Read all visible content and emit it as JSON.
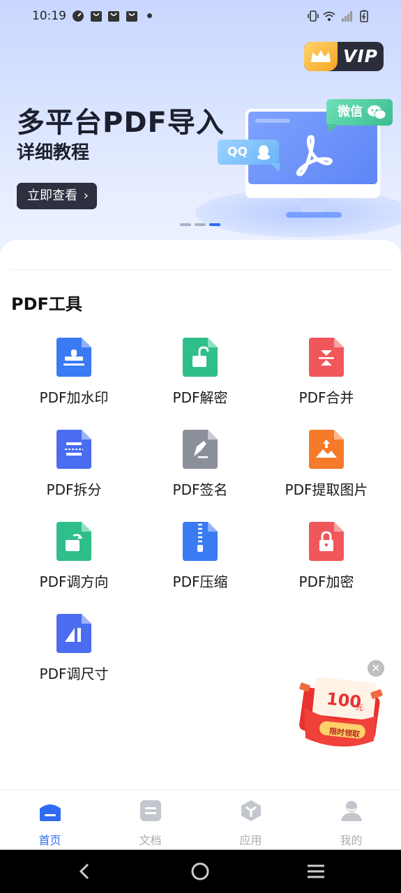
{
  "status_bar": {
    "time": "10:19",
    "icons": [
      "speedometer-icon",
      "shopping-bag-icon",
      "shopping-bag-icon",
      "shopping-bag-icon",
      "notification-dot-icon",
      "vibrate-icon",
      "wifi-icon",
      "signal-icon",
      "battery-charging-icon"
    ]
  },
  "banner": {
    "vip_label": "VIP",
    "title": "多平台PDF导入",
    "subtitle": "详细教程",
    "button_label": "立即查看",
    "qq_label": "QQ",
    "wechat_label": "微信",
    "carousel_total": 3,
    "carousel_active": 3
  },
  "tools": {
    "section_title": "PDF工具",
    "items": [
      {
        "label": "PDF加水印",
        "icon": "stamp-icon",
        "color": "#3a7af3"
      },
      {
        "label": "PDF解密",
        "icon": "unlock-icon",
        "color": "#2fbf8a"
      },
      {
        "label": "PDF合并",
        "icon": "merge-icon",
        "color": "#f0575a"
      },
      {
        "label": "PDF拆分",
        "icon": "split-icon",
        "color": "#4a6cf0"
      },
      {
        "label": "PDF签名",
        "icon": "signature-pen-icon",
        "color": "#8b8f9a"
      },
      {
        "label": "PDF提取图片",
        "icon": "image-extract-icon",
        "color": "#f57a2a"
      },
      {
        "label": "PDF调方向",
        "icon": "rotate-icon",
        "color": "#2fbf8a"
      },
      {
        "label": "PDF压缩",
        "icon": "zip-compress-icon",
        "color": "#3a7af3"
      },
      {
        "label": "PDF加密",
        "icon": "lock-icon",
        "color": "#f0575a"
      },
      {
        "label": "PDF调尺寸",
        "icon": "resize-icon",
        "color": "#4a6cf0"
      }
    ]
  },
  "promo": {
    "amount": "100",
    "unit": "元",
    "cta": "限时领取"
  },
  "tabbar": {
    "items": [
      {
        "label": "首页",
        "icon": "home-icon",
        "active": true
      },
      {
        "label": "文档",
        "icon": "document-icon",
        "active": false
      },
      {
        "label": "应用",
        "icon": "apps-cube-icon",
        "active": false
      },
      {
        "label": "我的",
        "icon": "profile-icon",
        "active": false
      }
    ]
  },
  "colors": {
    "accent": "#2f6bf2",
    "tab_inactive": "#a7abb3",
    "banner_button": "#2e3040"
  }
}
